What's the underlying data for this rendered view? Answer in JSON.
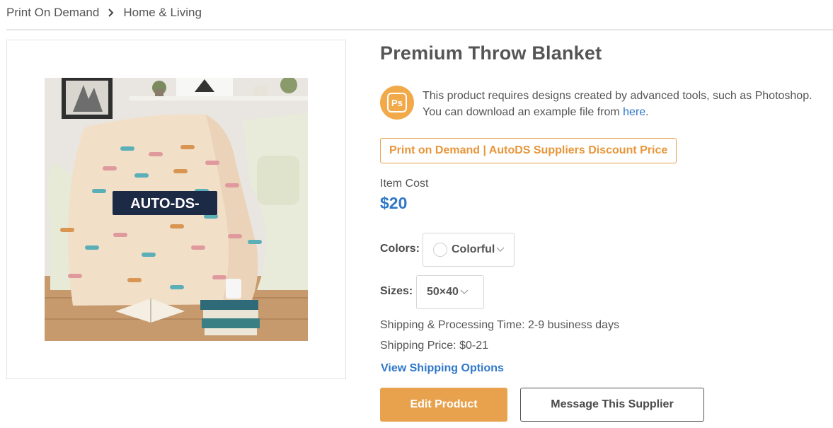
{
  "breadcrumb": {
    "items": [
      "Print On Demand",
      "Home & Living"
    ]
  },
  "product": {
    "title": "Premium Throw Blanket",
    "image_logo_text": "AUTO-DS-"
  },
  "notice": {
    "line1": "This product requires designs created by advanced tools, such as Photoshop.",
    "line2_prefix": "You can download an example file from ",
    "link_text": "here",
    "line2_suffix": ".",
    "badge_text": "Ps"
  },
  "tag": {
    "label": "Print on Demand | AutoDS Suppliers Discount Price"
  },
  "cost": {
    "label": "Item Cost",
    "value": "$20"
  },
  "options": {
    "colors_label": "Colors:",
    "colors_value": "Colorful",
    "sizes_label": "Sizes:",
    "sizes_value": "50×40"
  },
  "shipping": {
    "time": "Shipping & Processing Time: 2-9 business days",
    "price": "Shipping Price: $0-21",
    "link": "View Shipping Options"
  },
  "actions": {
    "edit": "Edit Product",
    "message": "Message This Supplier"
  },
  "colors": {
    "accent": "#e8a24d",
    "link": "#2f77c9",
    "blanket": "#f2dfc8"
  }
}
